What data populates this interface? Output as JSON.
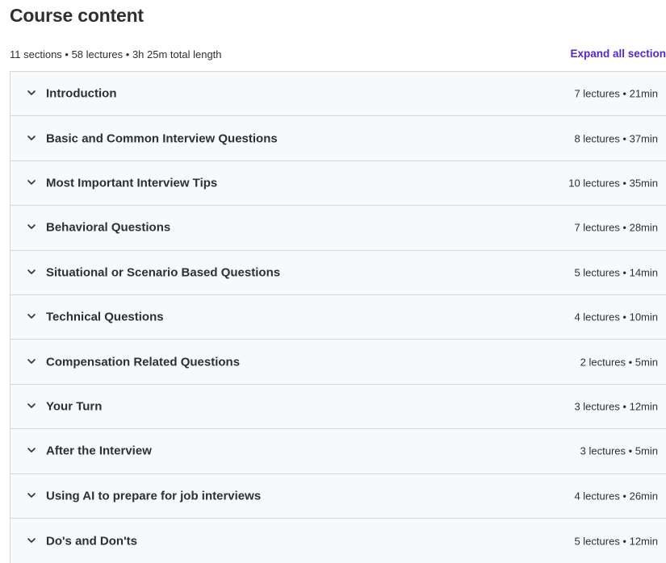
{
  "page": {
    "title": "Course content",
    "summary": "11 sections • 58 lectures • 3h 25m total length",
    "expand_label": "Expand all section"
  },
  "colors": {
    "accent": "#5624d0",
    "section_bg": "#f7f9fa",
    "border": "#d1d7dc",
    "text": "#2d2f31"
  },
  "sections": [
    {
      "title": "Introduction",
      "meta": "7 lectures • 21min",
      "icon": "chevron-down-icon"
    },
    {
      "title": "Basic and Common Interview Questions",
      "meta": "8 lectures • 37min",
      "icon": "chevron-down-icon"
    },
    {
      "title": "Most Important Interview Tips",
      "meta": "10 lectures • 35min",
      "icon": "chevron-down-icon"
    },
    {
      "title": "Behavioral Questions",
      "meta": "7 lectures • 28min",
      "icon": "chevron-down-icon"
    },
    {
      "title": "Situational or Scenario Based Questions",
      "meta": "5 lectures • 14min",
      "icon": "chevron-down-icon"
    },
    {
      "title": "Technical Questions",
      "meta": "4 lectures • 10min",
      "icon": "chevron-down-icon"
    },
    {
      "title": "Compensation Related Questions",
      "meta": "2 lectures • 5min",
      "icon": "chevron-down-icon"
    },
    {
      "title": "Your Turn",
      "meta": "3 lectures • 12min",
      "icon": "chevron-down-icon"
    },
    {
      "title": "After the Interview",
      "meta": "3 lectures • 5min",
      "icon": "chevron-down-icon"
    },
    {
      "title": "Using AI to prepare for job interviews",
      "meta": "4 lectures • 26min",
      "icon": "chevron-down-icon"
    },
    {
      "title": "Do's and Don'ts",
      "meta": "5 lectures • 12min",
      "icon": "chevron-down-icon"
    }
  ]
}
